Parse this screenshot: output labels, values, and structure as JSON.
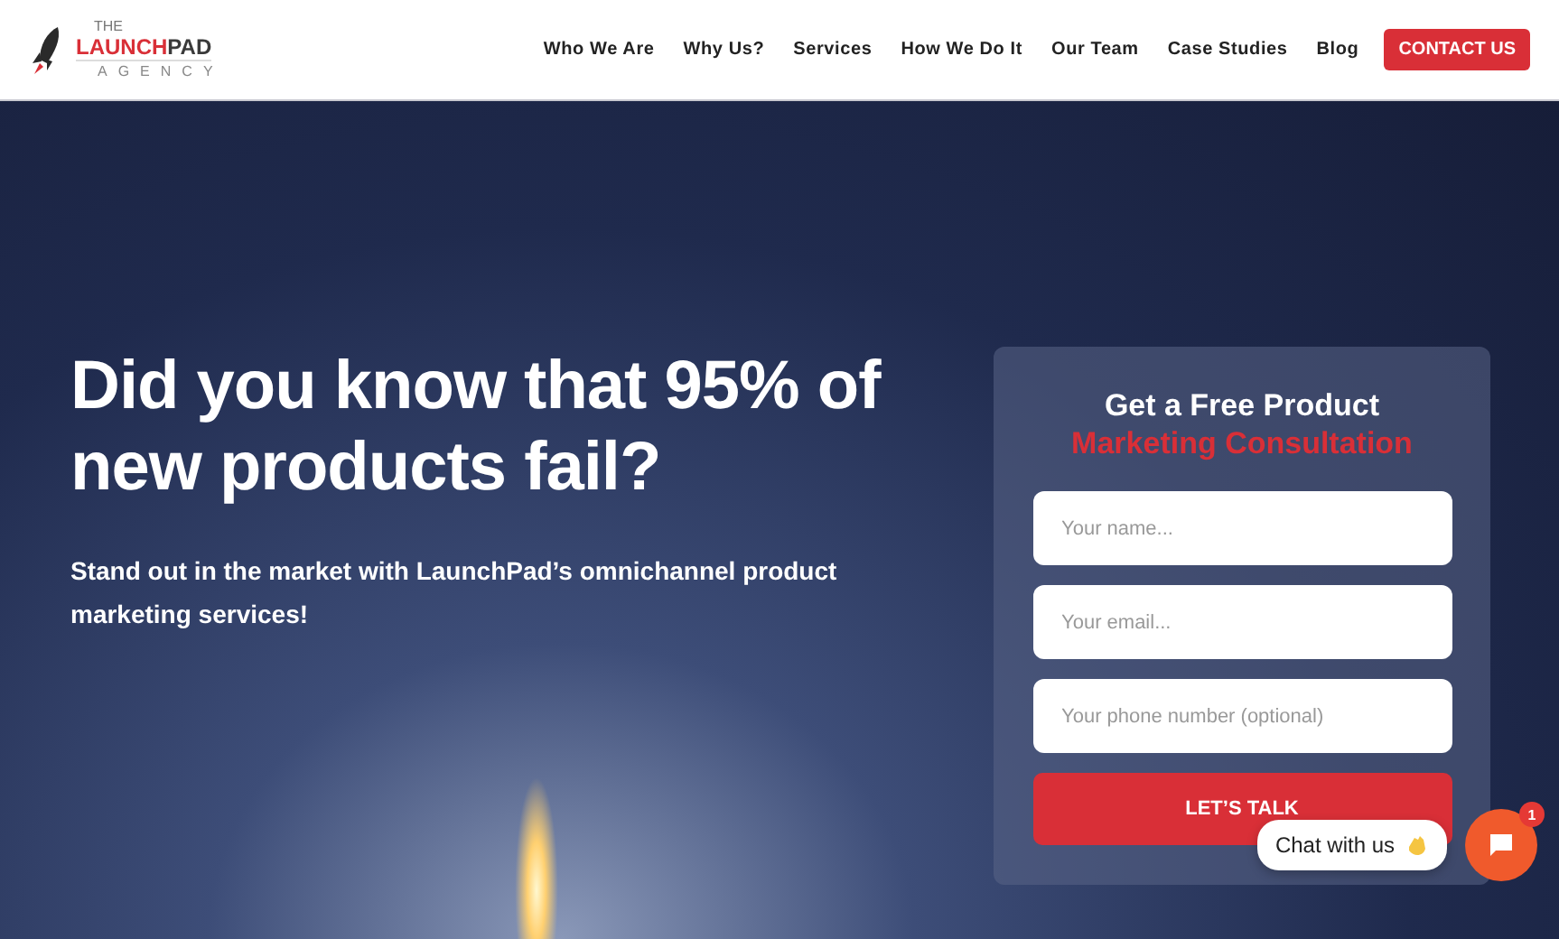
{
  "logo": {
    "top": "THE",
    "name_parts": [
      {
        "text": "LAUNCH",
        "color": "#d92f37"
      },
      {
        "text": "PAD",
        "color": "#3a3a3a"
      }
    ],
    "bottom": "AGENCY"
  },
  "nav": {
    "items": [
      {
        "label": "Who We Are"
      },
      {
        "label": "Why Us?"
      },
      {
        "label": "Services"
      },
      {
        "label": "How We Do It"
      },
      {
        "label": "Our Team"
      },
      {
        "label": "Case Studies"
      },
      {
        "label": "Blog"
      }
    ],
    "cta": "CONTACT US"
  },
  "hero": {
    "heading": "Did you know that 95% of new products fail?",
    "subheading": "Stand out in the market with LaunchPad’s omnichannel product marketing services!"
  },
  "form": {
    "title": "Get a Free Product",
    "title_highlight": "Marketing Consultation",
    "fields": [
      {
        "placeholder": "Your name..."
      },
      {
        "placeholder": "Your email..."
      },
      {
        "placeholder": "Your phone number (optional)"
      }
    ],
    "submit": "LET’S TALK"
  },
  "chat": {
    "label": "Chat with us",
    "badge": "1"
  }
}
